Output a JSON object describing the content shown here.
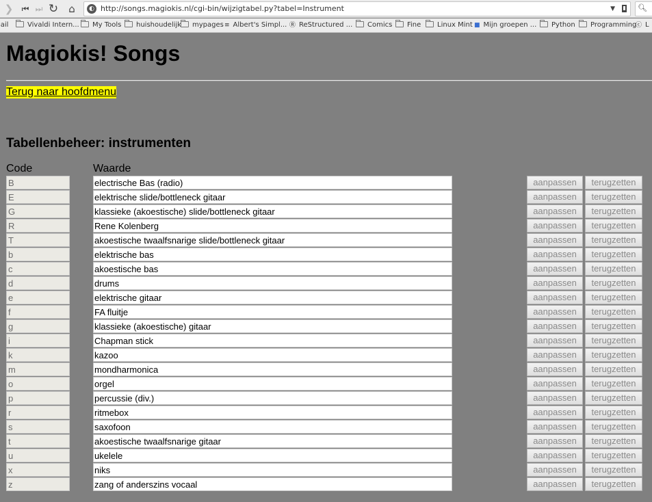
{
  "browser": {
    "url": "http://songs.magiokis.nl/cgi-bin/wijzigtabel.py?tabel=Instrument",
    "nav_icons": [
      "forward-icon",
      "rewind-icon",
      "fast-forward-icon",
      "reload-icon",
      "home-icon"
    ],
    "bookmarks": [
      {
        "label": "lail",
        "icon": "none"
      },
      {
        "label": "Vivaldi Intern...",
        "icon": "folder-icon"
      },
      {
        "label": "My Tools",
        "icon": "folder-icon"
      },
      {
        "label": "huishoudelijk",
        "icon": "folder-icon"
      },
      {
        "label": "mypages",
        "icon": "folder-icon"
      },
      {
        "label": "Albert's Simpl...",
        "icon": "site-icon"
      },
      {
        "label": "ReStructured ...",
        "icon": "site-icon"
      },
      {
        "label": "Comics",
        "icon": "folder-icon"
      },
      {
        "label": "Fine",
        "icon": "folder-icon"
      },
      {
        "label": "Linux Mint",
        "icon": "folder-icon"
      },
      {
        "label": "Mijn groepen ...",
        "icon": "site-icon"
      },
      {
        "label": "Python",
        "icon": "folder-icon"
      },
      {
        "label": "Programming",
        "icon": "folder-icon"
      },
      {
        "label": "L",
        "icon": "site-icon"
      }
    ]
  },
  "page": {
    "title": "Magiokis! Songs",
    "back_link": "Terug naar hoofdmenu",
    "subtitle": "Tabellenbeheer: instrumenten",
    "columns": {
      "code": "Code",
      "value": "Waarde"
    },
    "buttons": {
      "edit": "aanpassen",
      "reset": "terugzetten"
    },
    "rows": [
      {
        "code": "B",
        "value": "electrische Bas (radio)"
      },
      {
        "code": "E",
        "value": "elektrische slide/bottleneck gitaar"
      },
      {
        "code": "G",
        "value": "klassieke (akoestische) slide/bottleneck gitaar"
      },
      {
        "code": "R",
        "value": "Rene Kolenberg"
      },
      {
        "code": "T",
        "value": "akoestische twaalfsnarige slide/bottleneck gitaar"
      },
      {
        "code": "b",
        "value": "elektrische bas"
      },
      {
        "code": "c",
        "value": "akoestische bas"
      },
      {
        "code": "d",
        "value": "drums"
      },
      {
        "code": "e",
        "value": "elektrische gitaar"
      },
      {
        "code": "f",
        "value": "FA fluitje"
      },
      {
        "code": "g",
        "value": "klassieke (akoestische) gitaar"
      },
      {
        "code": "i",
        "value": "Chapman stick"
      },
      {
        "code": "k",
        "value": "kazoo"
      },
      {
        "code": "m",
        "value": "mondharmonica"
      },
      {
        "code": "o",
        "value": "orgel"
      },
      {
        "code": "p",
        "value": "percussie (div.)"
      },
      {
        "code": "r",
        "value": "ritmebox"
      },
      {
        "code": "s",
        "value": "saxofoon"
      },
      {
        "code": "t",
        "value": "akoestische twaalfsnarige gitaar"
      },
      {
        "code": "u",
        "value": "ukelele"
      },
      {
        "code": "x",
        "value": "niks"
      },
      {
        "code": "z",
        "value": "zang of anderszins vocaal"
      }
    ]
  }
}
